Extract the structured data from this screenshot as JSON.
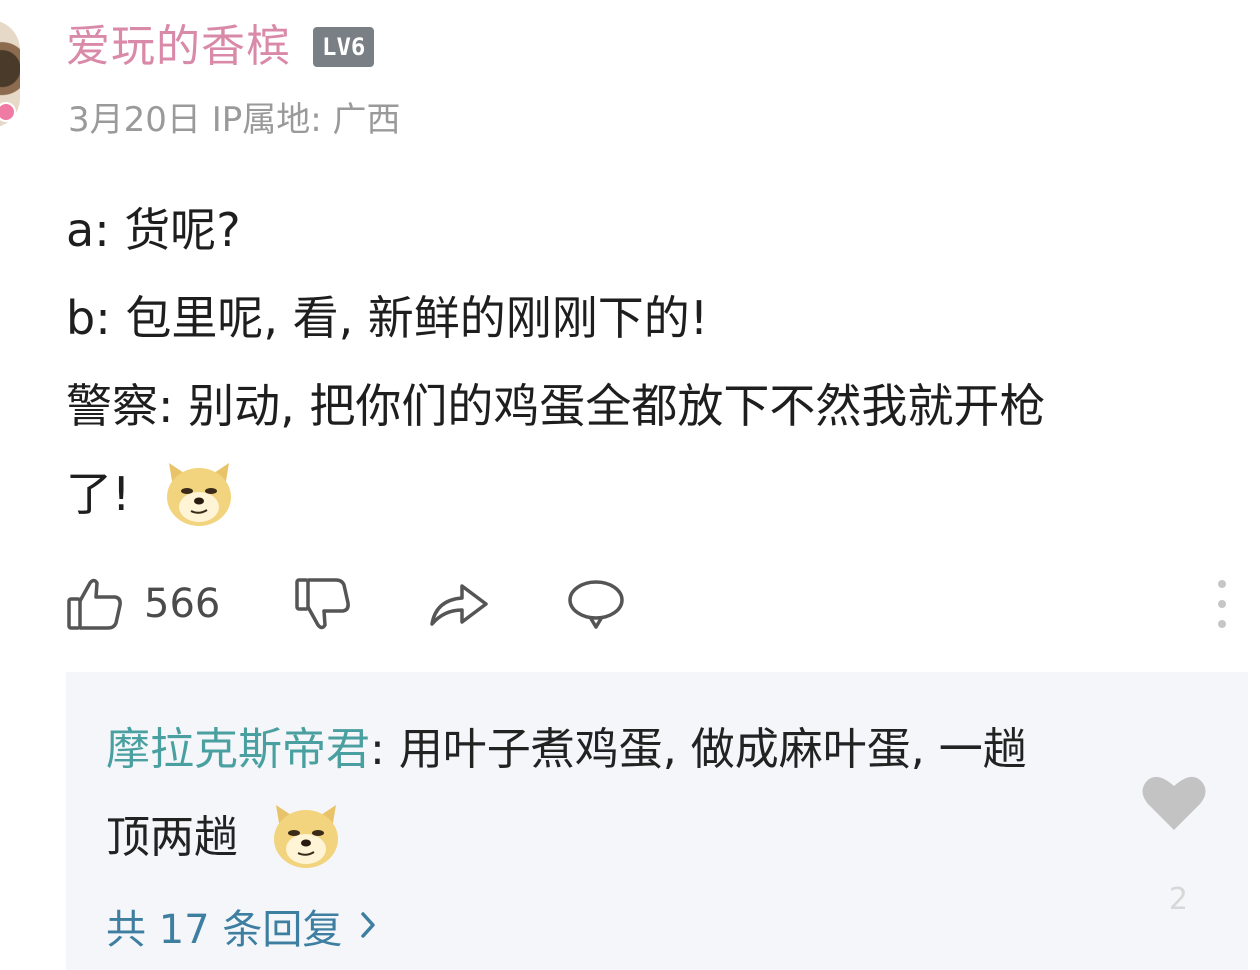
{
  "user": {
    "name": "爱玩的香槟",
    "level": "LV6",
    "meta": "3月20日 IP属地: 广西"
  },
  "comment": {
    "lines": [
      "a: 货呢?",
      "b: 包里呢, 看, 新鲜的刚刚下的!",
      "警察: 别动, 把你们的鸡蛋全都放下不然我就开枪",
      "了!"
    ],
    "emoji": "doge-emoji"
  },
  "actions": {
    "like_count": "566",
    "icons": [
      "thumbs-up-icon",
      "thumbs-down-icon",
      "share-icon",
      "comment-icon",
      "more-icon"
    ]
  },
  "reply": {
    "author": "摩拉克斯帝君",
    "separator": ": ",
    "text_line1": "用叶子煮鸡蛋, 做成麻叶蛋, 一趟",
    "text_line2": "顶两趟",
    "count_text": "共 17 条回复",
    "like_count": "2"
  },
  "colors": {
    "username": "#d98aa8",
    "reply_author": "#4aa0a0",
    "reply_link": "#3e7fa1",
    "reply_bg": "#f4f6f9"
  }
}
